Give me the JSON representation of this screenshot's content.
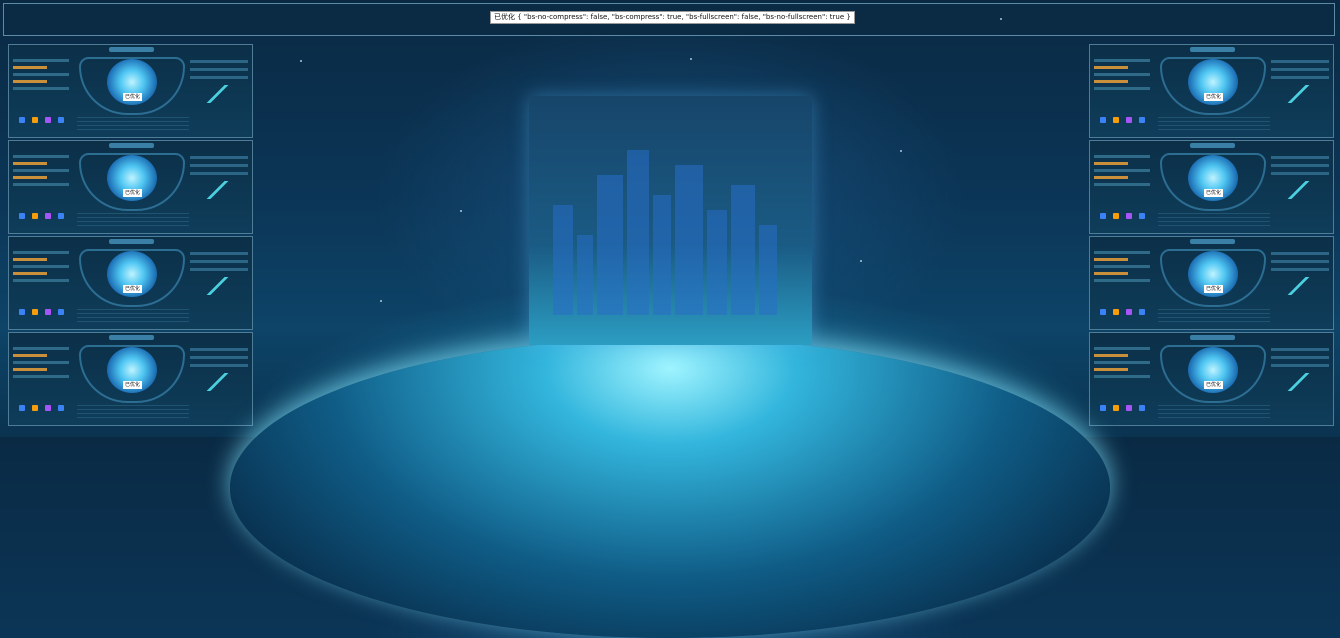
{
  "status_text": "已优化 { \"bs-no-compress\": false, \"bs-compress\": true, \"bs-fullscreen\": false, \"bs-no-fullscreen\": true }",
  "thumbnail_badge": "已优化",
  "colors": {
    "background": "#0b3556",
    "frame_border": "#5d8aa6",
    "accent_cyan": "#4fc6f2",
    "accent_gold": "#c98f3a"
  },
  "icons": [
    "globe-icon",
    "dashboard-thumbnail",
    "city-skyline-graphic",
    "earth-horizon-graphic"
  ]
}
